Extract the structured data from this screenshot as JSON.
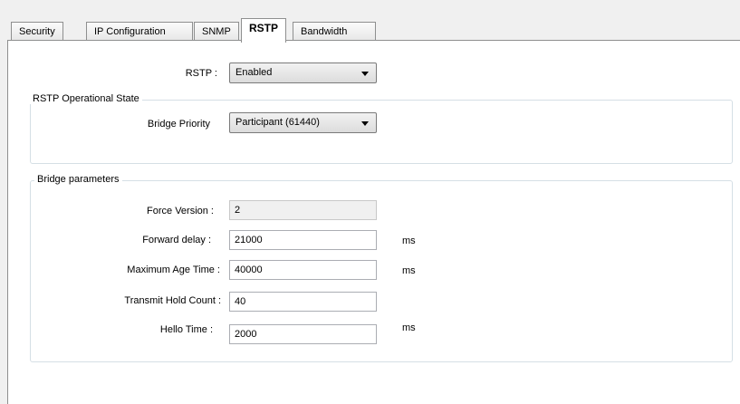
{
  "tabs": [
    {
      "label": "Security"
    },
    {
      "label": "IP Configuration"
    },
    {
      "label": "SNMP"
    },
    {
      "label": "RSTP",
      "active": true
    },
    {
      "label": "Bandwidth"
    }
  ],
  "rstp": {
    "label": "RSTP :",
    "value": "Enabled"
  },
  "operational_state": {
    "title": "RSTP Operational State",
    "bridge_priority_label": "Bridge Priority",
    "bridge_priority_value": "Participant (61440)"
  },
  "bridge_parameters": {
    "title": "Bridge parameters",
    "force_version": {
      "label": "Force Version :",
      "value": "2"
    },
    "forward_delay": {
      "label": "Forward delay :",
      "value": "21000",
      "unit": "ms"
    },
    "max_age_time": {
      "label": "Maximum Age Time :",
      "value": "40000",
      "unit": "ms"
    },
    "transmit_hold_count": {
      "label": "Transmit Hold Count :",
      "value": "40"
    },
    "hello_time": {
      "label": "Hello Time :",
      "value": "2000",
      "unit": "ms"
    }
  }
}
